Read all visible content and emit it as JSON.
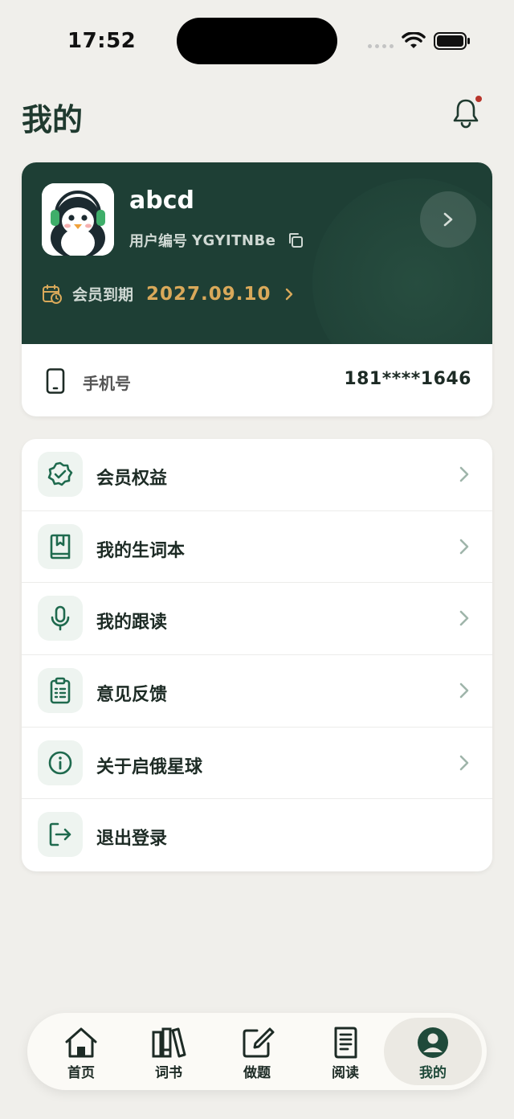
{
  "status_bar": {
    "time": "17:52"
  },
  "header": {
    "title": "我的"
  },
  "profile": {
    "username": "abcd",
    "userid_label": "用户编号",
    "userid_value": "YGYITNBe",
    "member_label": "会员到期",
    "member_date": "2027.09.10",
    "phone_label": "手机号",
    "phone_value": "181****1646"
  },
  "menu": {
    "items": [
      {
        "label": "会员权益",
        "icon": "badge-check-icon"
      },
      {
        "label": "我的生词本",
        "icon": "book-icon"
      },
      {
        "label": "我的跟读",
        "icon": "microphone-icon"
      },
      {
        "label": "意见反馈",
        "icon": "clipboard-icon"
      },
      {
        "label": "关于启俄星球",
        "icon": "info-icon"
      },
      {
        "label": "退出登录",
        "icon": "logout-icon"
      }
    ]
  },
  "tabs": [
    {
      "label": "首页",
      "icon": "home-icon"
    },
    {
      "label": "词书",
      "icon": "books-icon"
    },
    {
      "label": "做题",
      "icon": "edit-icon"
    },
    {
      "label": "阅读",
      "icon": "document-icon"
    },
    {
      "label": "我的",
      "icon": "user-icon",
      "active": true
    }
  ],
  "colors": {
    "background": "#f0efeb",
    "profile_bg": "#1e3f35",
    "accent_gold": "#d9a95a",
    "brand_green": "#1f5a45",
    "notification_dot": "#b8352b"
  }
}
